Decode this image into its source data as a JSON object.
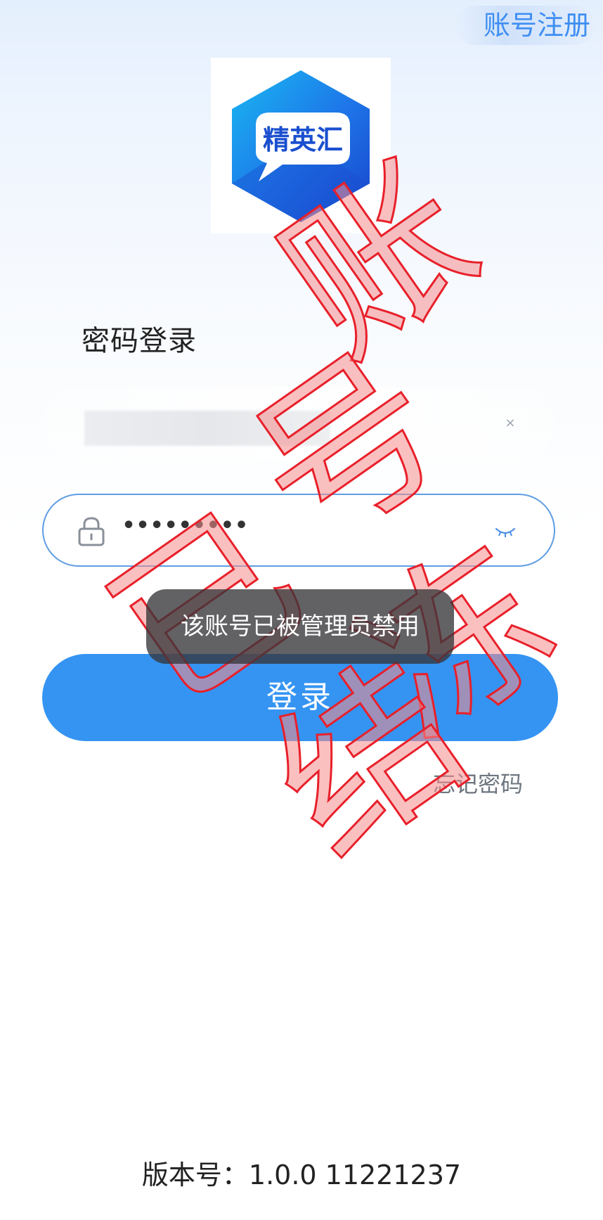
{
  "header": {
    "register_label": "账号注册"
  },
  "logo": {
    "text": "精英汇"
  },
  "login_form": {
    "title": "密码登录",
    "password_mask": "•••••••••",
    "submit_label": "登录",
    "forgot_label": "忘记密码"
  },
  "toast": {
    "message": "该账号已被管理员禁用"
  },
  "watermark": {
    "text": "账号已冻结"
  },
  "footer": {
    "version": "版本号：1.0.0 11221237"
  },
  "colors": {
    "primary": "#3594f2",
    "register_text": "#3e8ef2",
    "watermark": "#e8202a",
    "toast_bg": "#36363a"
  }
}
